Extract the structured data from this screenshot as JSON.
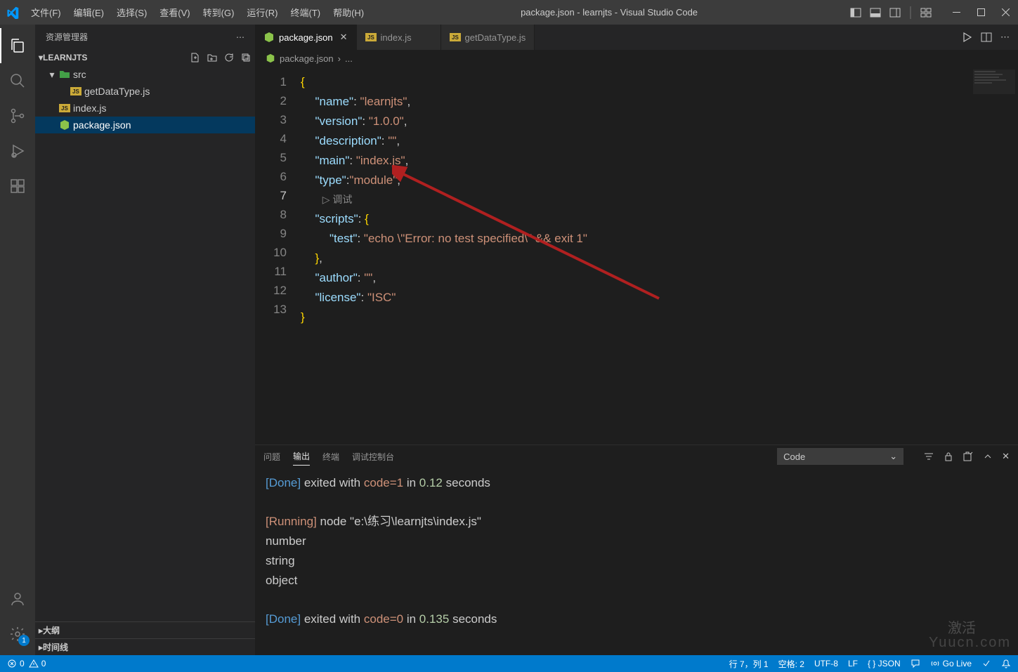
{
  "menu": {
    "file": "文件(F)",
    "edit": "编辑(E)",
    "select": "选择(S)",
    "view": "查看(V)",
    "goto": "转到(G)",
    "run": "运行(R)",
    "terminal": "终端(T)",
    "help": "帮助(H)"
  },
  "title": "package.json - learnjts - Visual Studio Code",
  "sidebar": {
    "header": "资源管理器",
    "projectName": "LEARNJTS",
    "items": [
      {
        "name": "src",
        "type": "folder",
        "depth": 1
      },
      {
        "name": "getDataType.js",
        "type": "js",
        "depth": 2
      },
      {
        "name": "index.js",
        "type": "js",
        "depth": 1
      },
      {
        "name": "package.json",
        "type": "json",
        "depth": 1,
        "selected": true
      }
    ],
    "outline": "大纲",
    "timeline": "时间线"
  },
  "tabs": [
    {
      "label": "package.json",
      "icon": "json",
      "active": true,
      "closeVisible": true
    },
    {
      "label": "index.js",
      "icon": "js",
      "active": false
    },
    {
      "label": "getDataType.js",
      "icon": "js",
      "active": false
    }
  ],
  "breadcrumb": {
    "file": "package.json",
    "rest": "..."
  },
  "code": {
    "lines": [
      "1",
      "2",
      "3",
      "4",
      "5",
      "6",
      "7",
      "8",
      "9",
      "10",
      "11",
      "12",
      "13"
    ],
    "debugHint": "调试",
    "json": {
      "name": "learnjts",
      "version": "1.0.0",
      "description": "",
      "main": "index.js",
      "type": "module",
      "scripts": {
        "test": "echo \\\"Error: no test specified\\\" && exit 1"
      },
      "author": "",
      "license": "ISC"
    }
  },
  "panel": {
    "tabs": {
      "problems": "问题",
      "output": "输出",
      "terminal": "终端",
      "debugConsole": "调试控制台"
    },
    "dropdown": "Code",
    "output": {
      "l1_a": "[Done]",
      "l1_b": " exited with ",
      "l1_c": "code=1",
      "l1_d": " in ",
      "l1_e": "0.12",
      "l1_f": " seconds",
      "l2_a": "[Running]",
      "l2_b": " node \"e:\\练习\\learnjts\\index.js\"",
      "l3": "number",
      "l4": "string",
      "l5": "object",
      "l6_a": "[Done]",
      "l6_b": " exited with ",
      "l6_c": "code=0",
      "l6_d": " in ",
      "l6_e": "0.135",
      "l6_f": " seconds"
    }
  },
  "status": {
    "errors": "0",
    "warnings": "0",
    "lineCol": "行 7，列 1",
    "spaces": "空格: 2",
    "encoding": "UTF-8",
    "eol": "LF",
    "lang": "{ }  JSON",
    "goLive": "Go Live",
    "activate": "激活",
    "settingsBadge": "1"
  },
  "watermarks": {
    "activate": "激活",
    "yuucn": "Yuucn.com"
  }
}
